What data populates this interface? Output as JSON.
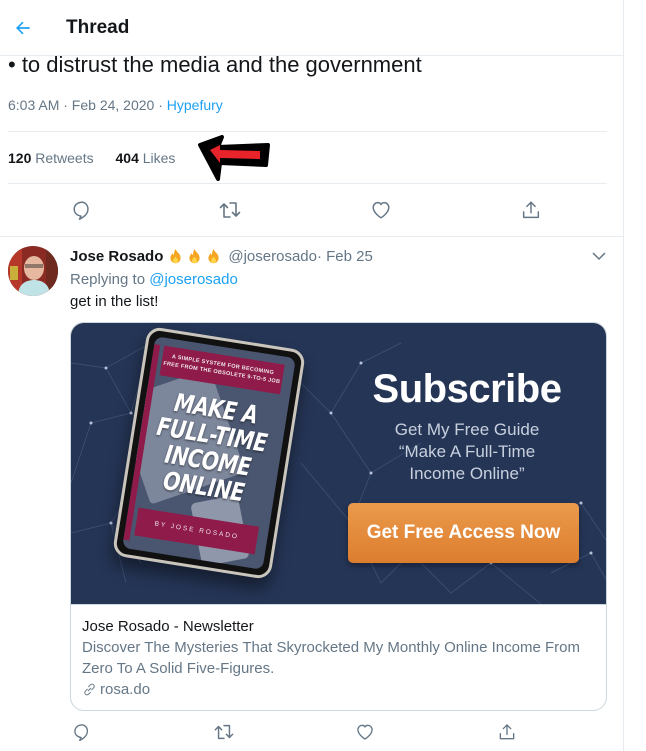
{
  "header": {
    "title": "Thread"
  },
  "main_tweet": {
    "text_tail": "• to distrust the media and the government",
    "time": "6:03 AM · Feb 24, 2020 · ",
    "source": "Hypefury",
    "retweets_count": "120",
    "retweets_label": " Retweets",
    "likes_count": "404",
    "likes_label": " Likes"
  },
  "annotation": {
    "arrow_fill": "#e8232a",
    "arrow_outline": "#000000"
  },
  "reply": {
    "name": "Jose Rosado",
    "emojis": [
      "🔥",
      "🔥",
      "🔥"
    ],
    "handle": "@joserosado",
    "date": " · Feb 25",
    "replying_prefix": "Replying to ",
    "replying_to": "@joserosado",
    "text": "get in the list!",
    "card": {
      "tablet_tagline_1": "A SIMPLE SYSTEM FOR BECOMING",
      "tablet_tagline_2": "FREE FROM THE OBSOLETE 9-TO-5 JOB",
      "tablet_title_1": "MAKE A",
      "tablet_title_2": "FULL-TIME",
      "tablet_title_3": "INCOME ONLINE",
      "tablet_author": "BY JOSE ROSADO",
      "headline": "Subscribe",
      "guide_line_1": "Get My Free Guide",
      "guide_line_2": "“Make A Full-Time",
      "guide_line_3": "Income Online”",
      "cta_label": "Get Free Access Now",
      "title": "Jose Rosado - Newsletter",
      "description": "Discover The Mysteries That Skyrocketed My Monthly Online Income From Zero To A Solid Five-Figures.",
      "domain": "rosa.do"
    }
  },
  "colors": {
    "accent": "#1da1f2",
    "secondary_text": "#657786",
    "card_bg": "#253556",
    "cta": "#e58a3c"
  }
}
